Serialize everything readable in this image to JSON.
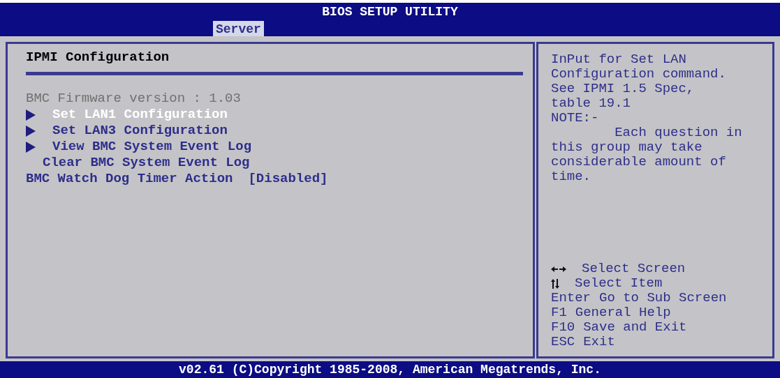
{
  "window": {
    "title": "BIOS SETUP UTILITY"
  },
  "tabs": [
    {
      "label": "Server",
      "selected": true
    }
  ],
  "panel": {
    "title": "IPMI Configuration",
    "items": [
      {
        "kind": "info",
        "label": "BMC Firmware version : 1.03",
        "selected": false
      },
      {
        "kind": "submenu",
        "label": "Set LAN1 Configuration",
        "selected": true
      },
      {
        "kind": "submenu",
        "label": "Set LAN3 Configuration",
        "selected": false
      },
      {
        "kind": "submenu",
        "label": "View BMC System Event Log",
        "selected": false
      },
      {
        "kind": "action",
        "label": "Clear BMC System Event Log",
        "selected": false
      },
      {
        "kind": "option",
        "label": "BMC Watch Dog Timer Action",
        "value": "[Disabled]",
        "selected": false
      }
    ]
  },
  "help": {
    "text": "InPut for Set LAN\nConfiguration command.\nSee IPMI 1.5 Spec,\ntable 19.1\nNOTE:-\n        Each question in\nthis group may take\nconsiderable amount of\ntime.",
    "keys": [
      {
        "kind": "left-right",
        "action": "Select Screen"
      },
      {
        "kind": "up-down",
        "action": "Select Item"
      },
      {
        "kind": "text",
        "key": "Enter",
        "action": "Go to Sub Screen"
      },
      {
        "kind": "text",
        "key": "F1",
        "action": "General Help"
      },
      {
        "kind": "text",
        "key": "F10",
        "action": "Save and Exit"
      },
      {
        "kind": "text",
        "key": "ESC",
        "action": "Exit"
      }
    ]
  },
  "status_bar": "v02.61 (C)Copyright 1985-2008, American Megatrends, Inc."
}
